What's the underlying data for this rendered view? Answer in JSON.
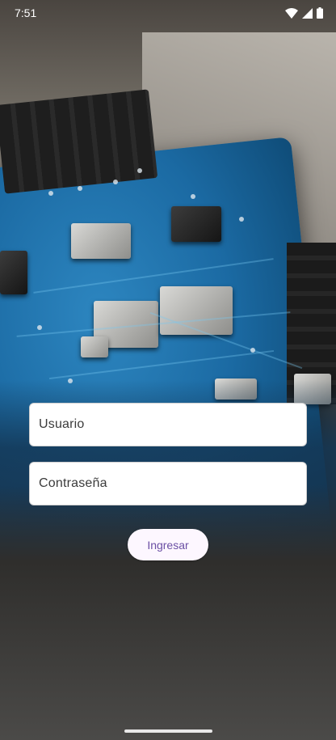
{
  "status_bar": {
    "time": "7:51",
    "icons": [
      "wifi-icon",
      "cell-signal-icon",
      "battery-icon"
    ]
  },
  "background": {
    "description_icon": "circuit-board-photo"
  },
  "login_form": {
    "username_placeholder": "Usuario",
    "password_placeholder": "Contraseña",
    "submit_label": "Ingresar"
  },
  "colors": {
    "button_bg": "#fdf7ff",
    "button_text": "#6b4fa4",
    "field_bg": "#ffffff"
  }
}
